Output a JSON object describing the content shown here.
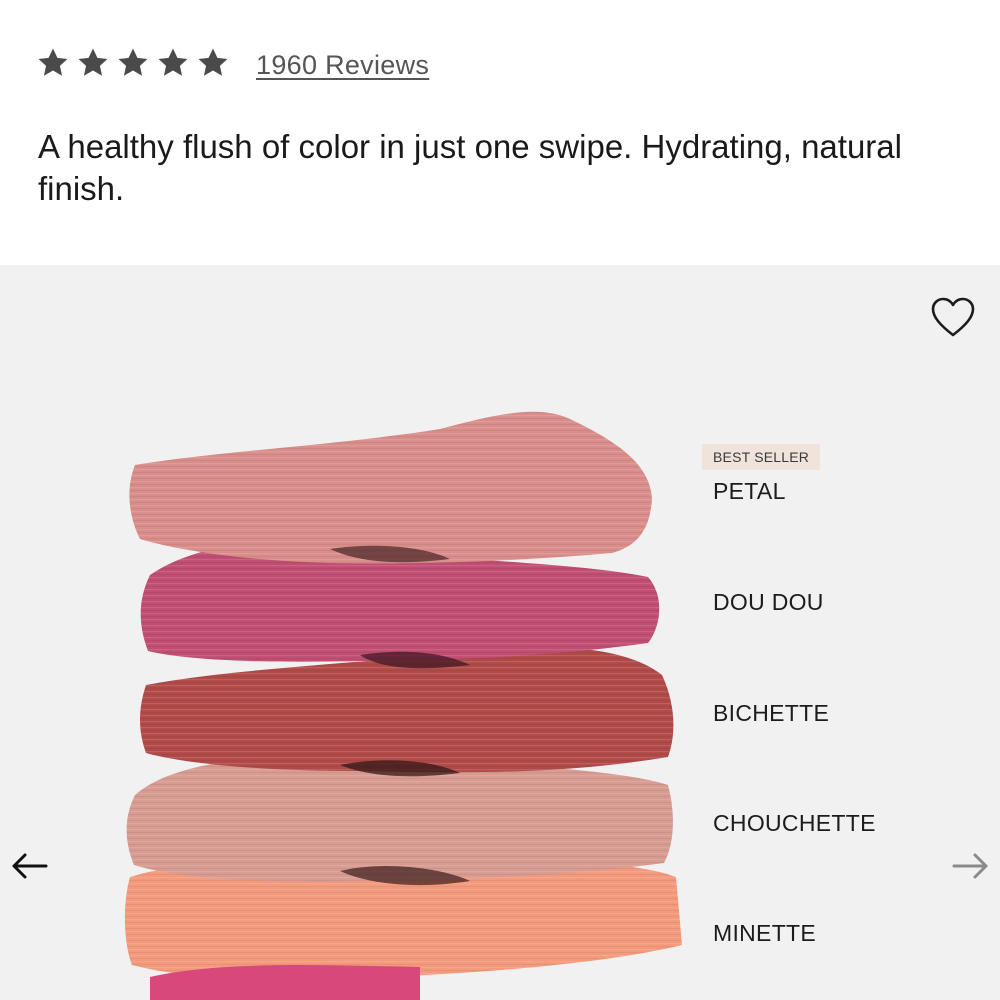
{
  "rating": {
    "stars": 5,
    "max_stars": 5,
    "reviews_label": "1960 Reviews"
  },
  "description": "A healthy flush of color in just one swipe. Hydrating, natural finish.",
  "gallery": {
    "favorite_icon": "heart-outline-icon",
    "prev_icon": "arrow-left-icon",
    "next_icon": "arrow-right-icon",
    "badge": "BEST SELLER",
    "shades": [
      {
        "name": "PETAL",
        "color": "#d98d8a"
      },
      {
        "name": "DOU DOU",
        "color": "#c04d72"
      },
      {
        "name": "BICHETTE",
        "color": "#b04a48"
      },
      {
        "name": "CHOUCHETTE",
        "color": "#d79b92"
      },
      {
        "name": "MINETTE",
        "color": "#f39a7d"
      }
    ]
  },
  "colors": {
    "star": "#4a4a4a",
    "gallery_bg": "#f1f1f1",
    "badge_bg": "#f0e3dc"
  }
}
